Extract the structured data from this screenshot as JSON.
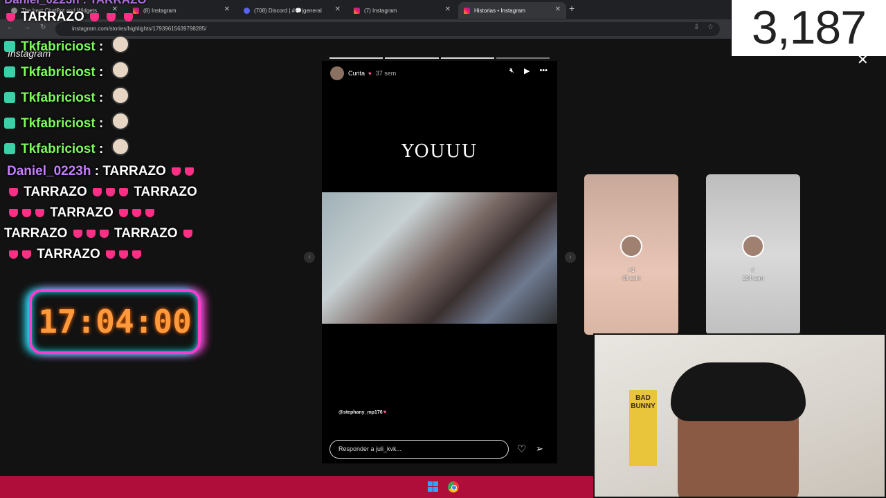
{
  "browser": {
    "tabs": [
      {
        "label": "The best ChatBot and Widgets",
        "icon": "generic-favicon-icon",
        "active": false
      },
      {
        "label": "(8) Instagram",
        "icon": "instagram-favicon-icon",
        "active": false
      },
      {
        "label": "(708) Discord | #💬|general",
        "icon": "discord-favicon-icon",
        "active": false
      },
      {
        "label": "(7) Instagram",
        "icon": "instagram-favicon-icon",
        "active": false
      },
      {
        "label": "Historias • Instagram",
        "icon": "instagram-favicon-icon",
        "active": true
      }
    ],
    "new_tab": "+",
    "url": "instagram.com/stories/highlights/17939615639798285/"
  },
  "viewer_count": "3,187",
  "chat": {
    "top_partial": "Daniel_0223h : TARRAZO",
    "top_text": "TARRAZO",
    "instagram_label": "Instagram",
    "messages": [
      {
        "user": "Tkfabriciost",
        "sep": ":"
      },
      {
        "user": "Tkfabriciost",
        "sep": ":"
      },
      {
        "user": "Tkfabriciost",
        "sep": ":"
      },
      {
        "user": "Tkfabriciost",
        "sep": ":"
      },
      {
        "user": "Tkfabriciost",
        "sep": ":"
      }
    ],
    "daniel": {
      "user": "Daniel_0223h",
      "sep": ":",
      "word": "TARRAZO"
    }
  },
  "clock": "17:04:00",
  "story": {
    "user": "Curita",
    "time": "37 sem",
    "text": "YOUUU",
    "mention": "@stephany_mp176",
    "reply_placeholder": "Responder a juli_kvk...",
    "progress_total": 4,
    "progress_done": 3
  },
  "highlights": [
    {
      "title": ">3",
      "time": "48 sem"
    },
    {
      "title": "/:",
      "time": "104 sem"
    }
  ],
  "webcam": {
    "poster_text": "BAD BUNNY"
  },
  "colors": {
    "taskbar": "#b00e3a",
    "clock_text": "#ff9a3c",
    "chat_green": "#7cfc5a",
    "chat_purple": "#c77dff"
  }
}
